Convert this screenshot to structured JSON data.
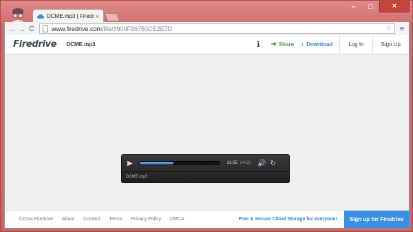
{
  "browser": {
    "tab_title": "DCME.mp3 | Firedrive",
    "tab_close": "×",
    "url_host": "www.firedrive.com",
    "url_path": "/file/3900F89750CE2E7D",
    "back_glyph": "←",
    "forward_glyph": "→",
    "reload_glyph": "C",
    "star_glyph": "☆",
    "menu_glyph": "≡",
    "win_min": "–",
    "win_max": "□",
    "win_close": "×"
  },
  "header": {
    "logo": "Firedrive",
    "file_name": "DCME.mp3",
    "info_glyph": "i",
    "share_label": "Share",
    "share_glyph": "➜",
    "download_label": "Download",
    "download_glyph": "↓",
    "login_label": "Log In",
    "signup_label": "Sign Up"
  },
  "player": {
    "play_glyph": "▶",
    "progress": 0.42,
    "time_current": "01:55",
    "time_total": "04:35",
    "volume_glyph": "🔊",
    "replay_glyph": "↻",
    "track_title": "DCME.mp3"
  },
  "footer": {
    "copyright": "©2014 Firedrive",
    "links": [
      "About",
      "Contact",
      "Terms",
      "Privacy Policy",
      "DMCA"
    ],
    "promo_text": "Free & Secure Cloud Storage for everyone!",
    "signup_cta": "Sign up for Firedrive"
  },
  "colors": {
    "window_frame": "#d86f6f",
    "share": "#3aa04a",
    "download": "#2f7fd0",
    "cta": "#3b8fe0",
    "progress_fill": "#2a7ad0"
  }
}
